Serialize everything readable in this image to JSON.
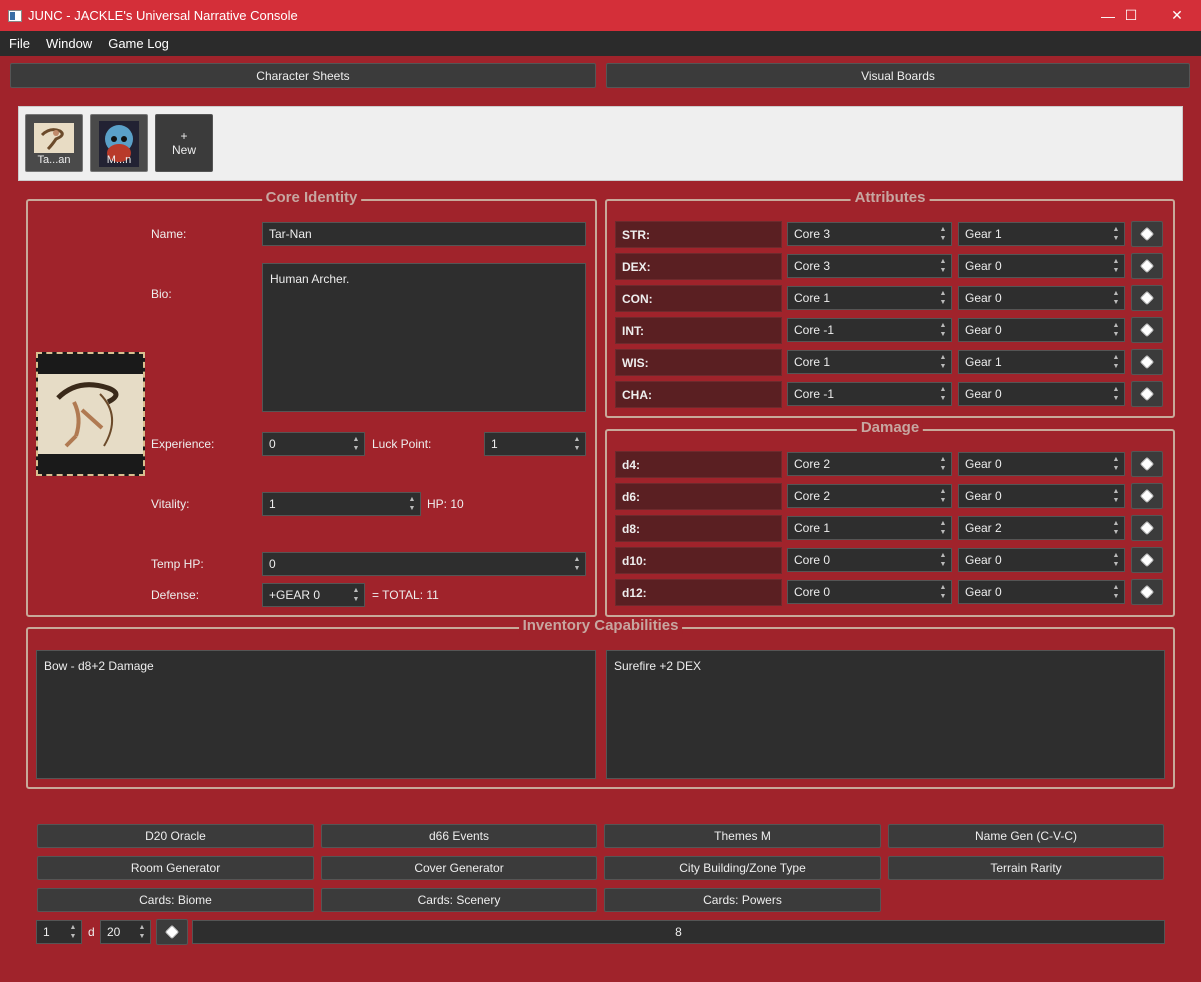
{
  "window": {
    "title": "JUNC - JACKLE's Universal Narrative Console",
    "minimize_glyph": "—",
    "maximize_glyph": "☐",
    "close_glyph": "✕"
  },
  "menu": [
    "File",
    "Window",
    "Game Log"
  ],
  "nav_tabs": {
    "character_sheets": "Character Sheets",
    "visual_boards": "Visual Boards"
  },
  "characters": [
    {
      "label": "Ta...an"
    },
    {
      "label": "M...n"
    }
  ],
  "new_button": {
    "plus": "+",
    "label": "New"
  },
  "core_identity": {
    "title": "Core Identity",
    "name_label": "Name:",
    "name_value": "Tar-Nan",
    "bio_label": "Bio:",
    "bio_value": "Human Archer.",
    "experience_label": "Experience:",
    "experience_value": "0",
    "luck_label": "Luck Point:",
    "luck_value": "1",
    "vitality_label": "Vitality:",
    "vitality_value": "1",
    "hp_text": "HP: 10",
    "temp_hp_label": "Temp HP:",
    "temp_hp_value": "0",
    "defense_label": "Defense:",
    "defense_value": "+GEAR 0",
    "defense_total": "= TOTAL: 11"
  },
  "attributes": {
    "title": "Attributes",
    "rows": [
      {
        "name": "STR:",
        "core": "Core 3",
        "gear": "Gear 1"
      },
      {
        "name": "DEX:",
        "core": "Core 3",
        "gear": "Gear 0"
      },
      {
        "name": "CON:",
        "core": "Core 1",
        "gear": "Gear 0"
      },
      {
        "name": "INT:",
        "core": "Core -1",
        "gear": "Gear 0"
      },
      {
        "name": "WIS:",
        "core": "Core 1",
        "gear": "Gear 1"
      },
      {
        "name": "CHA:",
        "core": "Core -1",
        "gear": "Gear 0"
      }
    ]
  },
  "damage": {
    "title": "Damage",
    "rows": [
      {
        "name": "d4:",
        "core": "Core 2",
        "gear": "Gear 0"
      },
      {
        "name": "d6:",
        "core": "Core 2",
        "gear": "Gear 0"
      },
      {
        "name": "d8:",
        "core": "Core 1",
        "gear": "Gear 2"
      },
      {
        "name": "d10:",
        "core": "Core 0",
        "gear": "Gear 0"
      },
      {
        "name": "d12:",
        "core": "Core 0",
        "gear": "Gear 0"
      }
    ]
  },
  "inventory": {
    "title": "Inventory  Capabilities",
    "inventory_text": "Bow - d8+2 Damage",
    "capabilities_text": "Surefire +2 DEX"
  },
  "tools": [
    "D20 Oracle",
    "d66 Events",
    "Themes M",
    "Name Gen (C-V-C)",
    "Room Generator",
    "Cover Generator",
    "City Building/Zone Type",
    "Terrain Rarity",
    "Cards: Biome",
    "Cards: Scenery",
    "Cards: Powers"
  ],
  "roller": {
    "count": "1",
    "d_label": "d",
    "sides": "20",
    "result": "8"
  },
  "colors": {
    "background": "#a0232b",
    "titlebar": "#d42f39",
    "group_title": "#c7a6a0"
  }
}
